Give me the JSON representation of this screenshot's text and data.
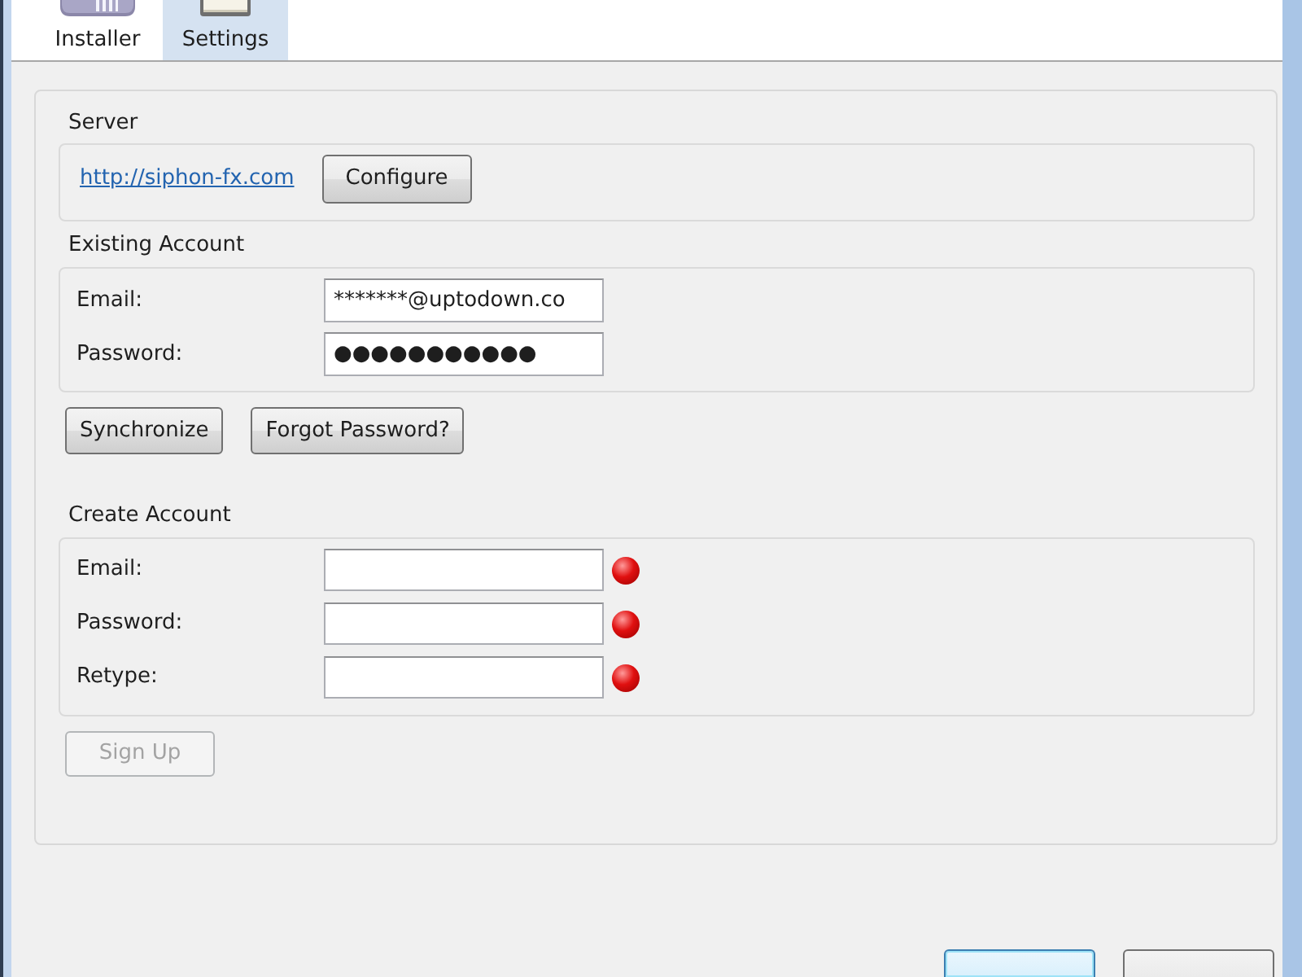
{
  "tabs": [
    {
      "label": "Installer",
      "selected": false
    },
    {
      "label": "Settings",
      "selected": true
    }
  ],
  "server": {
    "title": "Server",
    "url": "http://siphon-fx.com",
    "button": "Configure"
  },
  "existing_account": {
    "title": "Existing Account",
    "fields": [
      {
        "label": "Email:",
        "value": "*******@uptodown.co"
      },
      {
        "label": "Password:",
        "value": "●●●●●●●●●●●"
      }
    ],
    "buttons": [
      {
        "label": "Synchronize",
        "disabled": false
      },
      {
        "label": "Forgot Password?",
        "disabled": false
      }
    ]
  },
  "create_account": {
    "title": "Create Account",
    "fields": [
      {
        "label": "Email:",
        "valid": false
      },
      {
        "label": "Password:",
        "valid": false
      },
      {
        "label": "Retype:",
        "valid": false
      }
    ],
    "button": {
      "label": "Sign Up",
      "disabled": true
    }
  },
  "dialog_buttons": [
    {
      "focused": true
    },
    {
      "focused": false
    }
  ]
}
